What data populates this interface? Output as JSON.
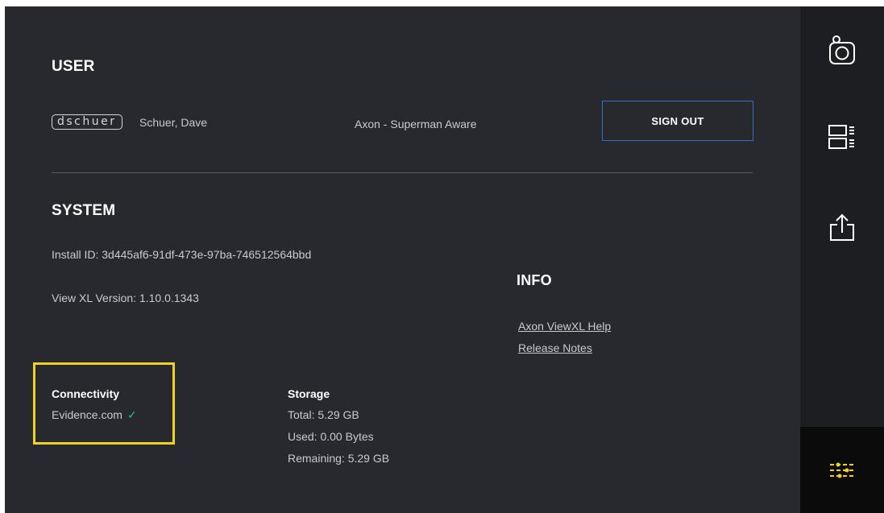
{
  "user": {
    "section_title": "USER",
    "username_badge": "dschuer",
    "full_name": "Schuer, Dave",
    "organization": "Axon - Superman Aware",
    "sign_out_label": "SIGN OUT"
  },
  "system": {
    "section_title": "SYSTEM",
    "install_id": "Install ID: 3d445af6-91df-473e-97ba-746512564bbd",
    "version": "View XL Version: 1.10.0.1343"
  },
  "info": {
    "section_title": "INFO",
    "help_link": "Axon ViewXL Help",
    "release_notes_link": "Release Notes"
  },
  "connectivity": {
    "title": "Connectivity",
    "status": "Evidence.com",
    "status_icon": "checkmark-icon",
    "status_color": "#22c57a"
  },
  "storage": {
    "title": "Storage",
    "total": "Total: 5.29 GB",
    "used": "Used: 0.00 Bytes",
    "remaining": "Remaining: 5.29 GB"
  },
  "rail": {
    "items": [
      {
        "icon": "camera-device-icon",
        "active": false
      },
      {
        "icon": "layout-list-icon",
        "active": false
      },
      {
        "icon": "export-share-icon",
        "active": false
      },
      {
        "icon": "settings-sliders-icon",
        "active": true
      }
    ],
    "accent_color": "#f2d21b"
  },
  "colors": {
    "background": "#27292e",
    "rail_background": "#1d1e21",
    "sign_out_border": "#2f6fc4",
    "highlight_border": "#f2d21b"
  }
}
